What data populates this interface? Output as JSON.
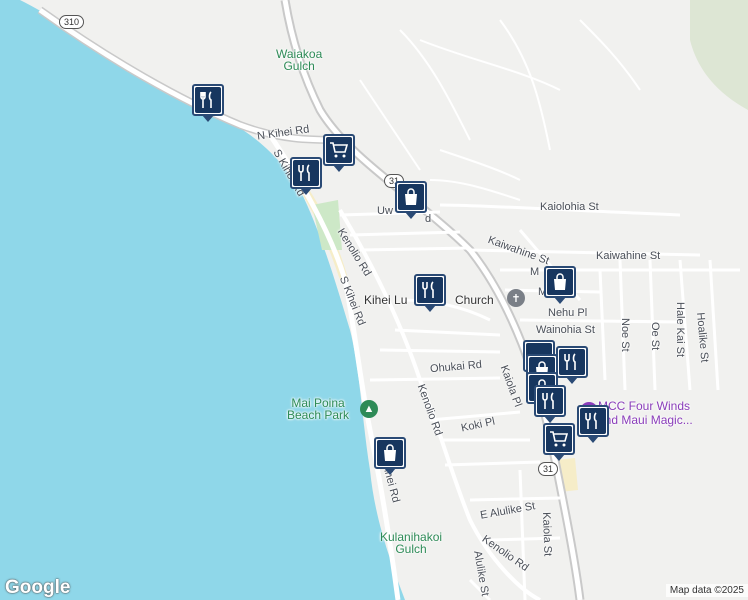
{
  "colors": {
    "water": "#8fd7e9",
    "land": "#f1f1ef",
    "road": "#ffffff",
    "highway": "#c9c9c9",
    "pin": "#17365f",
    "park": "#cde8c7",
    "sand": "#f6edc8"
  },
  "places": {
    "waiakoa_gulch": "Waiakoa\nGulch",
    "kulanihakoi_gulch": "Kulanihakoi\nGulch",
    "mai_poina_beach_park": "Mai Poina\nBeach Park",
    "church": "Kihei Lu",
    "church_tail": "Church",
    "mcc": "MCC Four Winds\nand Maui Magic..."
  },
  "roads": {
    "n_kihei_rd": "N Kihei Rd",
    "s_kihei_rd_1": "S Kihei Rd",
    "s_kihei_rd_2": "S Kihei Rd",
    "s_kihei_rd_3": "ihei Rd",
    "uwa": "Uw",
    "uwa_tail": "d",
    "kenolio_rd_1": "Kenolio Rd",
    "kenolio_rd_2": "Kenolio Rd",
    "kenolio_rd_3": "Kenolio Rd",
    "kaiolohia_st": "Kaiolohia St",
    "kaiwahine_st_1": "Kaiwahine St",
    "kaiwahine_st_2": "Kaiwahine St",
    "nehu_pl": "Nehu Pl",
    "wainohia_st": "Wainohia St",
    "ohukai_rd": "Ohukai Rd",
    "kaiola_pl": "Kaiola Pl",
    "koki_pl": "Koki Pl",
    "noe_st": "Noe St",
    "oe_st": "Oe St",
    "hale_kai_st": "Hale Kai St",
    "hoalike_st": "Hoalike St",
    "e_alulike_st": "E Alulike St",
    "alulike_st": "Alulike St",
    "kaiola_st": "Kaiola St",
    "m1": "M",
    "m2": "M"
  },
  "shields": {
    "route_310": "310",
    "route_31_a": "31",
    "route_31_b": "31"
  },
  "pins": [
    {
      "type": "restaurant",
      "icon": "fork-knife-icon"
    },
    {
      "type": "grocery",
      "icon": "cart-icon"
    },
    {
      "type": "restaurant",
      "icon": "fork-knife-icon"
    },
    {
      "type": "shopping",
      "icon": "shopping-bag-icon"
    },
    {
      "type": "restaurant",
      "icon": "fork-knife-icon"
    },
    {
      "type": "shopping",
      "icon": "shopping-bag-icon"
    },
    {
      "type": "shopping",
      "icon": "shopping-bag-icon"
    },
    {
      "type": "restaurant",
      "icon": "fork-knife-icon"
    },
    {
      "type": "grocery",
      "icon": "cart-icon"
    },
    {
      "type": "restaurant",
      "icon": "fork-knife-icon"
    },
    {
      "type": "shopping",
      "icon": "shopping-bag-icon"
    }
  ],
  "footer": {
    "logo": "Google",
    "attribution": "Map data ©2025"
  }
}
